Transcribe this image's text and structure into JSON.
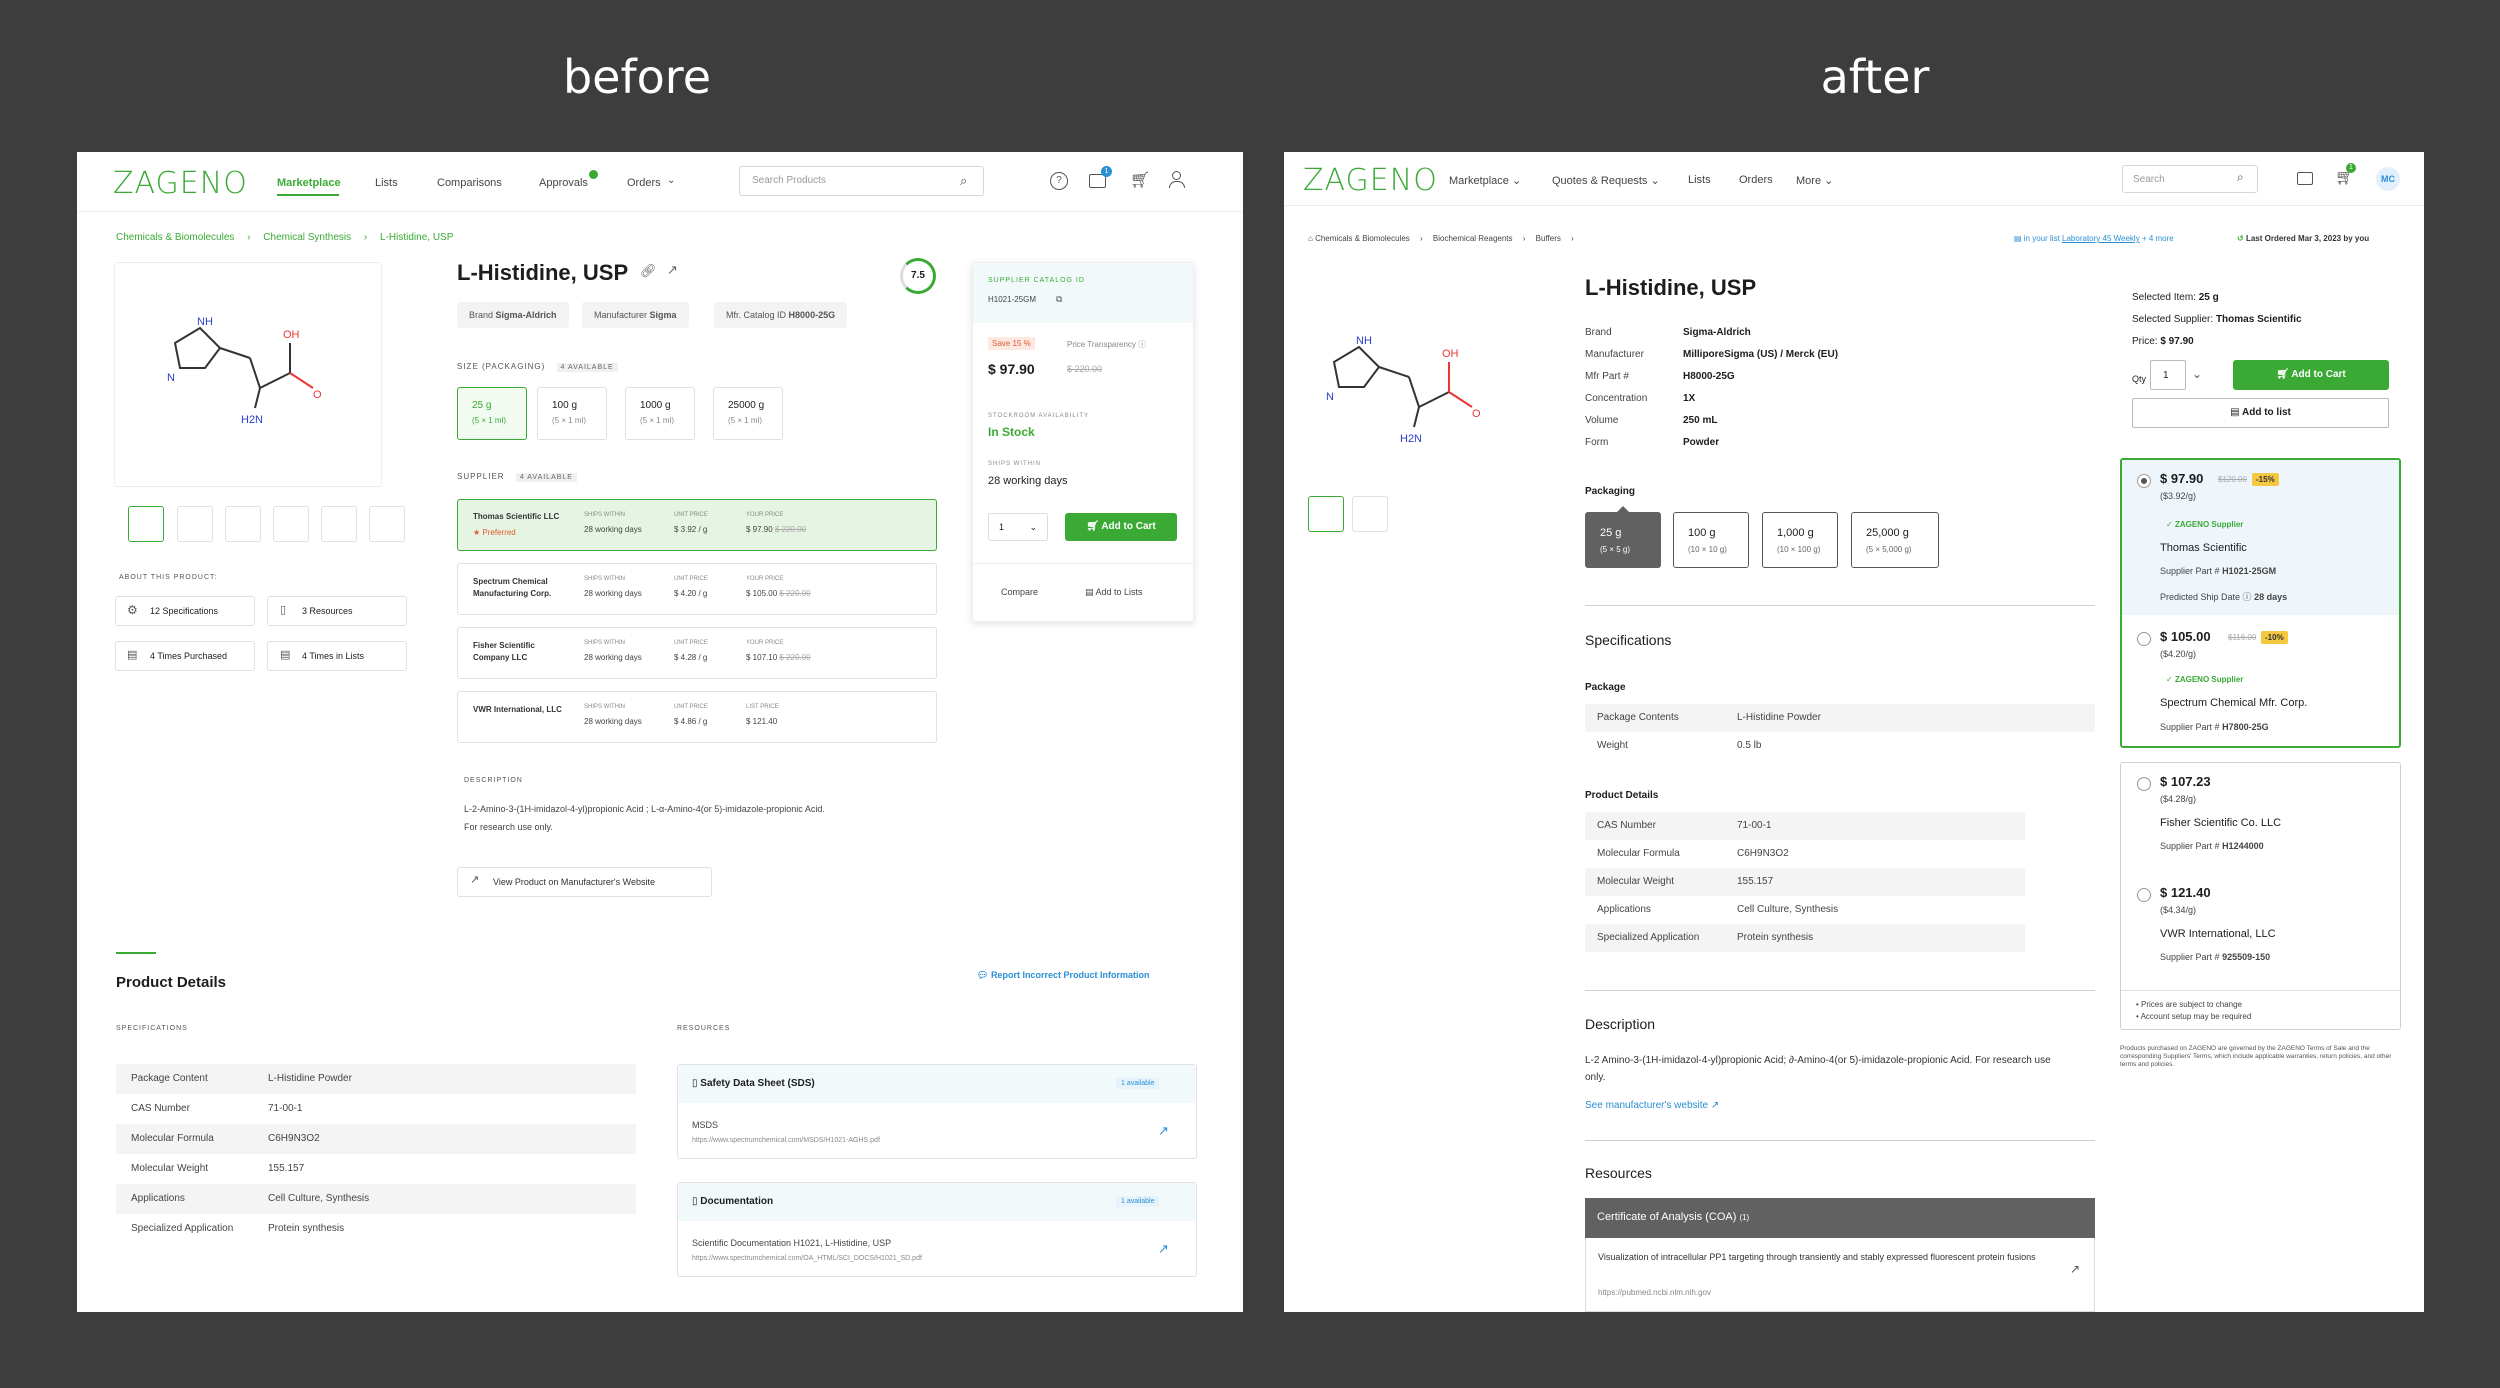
{
  "captions": {
    "before": "before",
    "after": "after"
  },
  "before": {
    "logo": "ZAGENO",
    "nav": [
      "Marketplace",
      "Lists",
      "Comparisons",
      "Approvals",
      "Orders"
    ],
    "search_placeholder": "Search Products",
    "cart_badge": "1",
    "breadcrumb": [
      "Chemicals & Biomolecules",
      "Chemical Synthesis",
      "L-Histidine, USP"
    ],
    "title": "L-Histidine, USP",
    "score": "7.5",
    "chips": {
      "brand_label": "Brand",
      "brand": "Sigma-Aldrich",
      "mfr_label": "Manufacturer",
      "mfr": "Sigma",
      "cat_label": "Mfr. Catalog ID",
      "cat": "H8000-25G"
    },
    "size_label": "SIZE (PACKAGING)",
    "size_avail": "4 available",
    "sizes": [
      {
        "v": "25 g",
        "s": "(5 × 1 ml)"
      },
      {
        "v": "100 g",
        "s": "(5 × 1 ml)"
      },
      {
        "v": "1000 g",
        "s": "(5 × 1 ml)"
      },
      {
        "v": "25000 g",
        "s": "(5 × 1 ml)"
      }
    ],
    "supplier_label": "SUPPLIER",
    "supplier_avail": "4 available",
    "col_ships": "SHIPS WITHIN",
    "col_unit": "UNIT PRICE",
    "col_your": "YOUR PRICE",
    "col_list": "LIST PRICE",
    "preferred": "Preferred",
    "suppliers": [
      {
        "name": "Thomas Scientific LLC",
        "ships": "28 working days",
        "unit": "$ 3.92 / g",
        "price": "$ 97.90",
        "old": "$ 220.00"
      },
      {
        "name": "Spectrum Chemical Manufacturing Corp.",
        "ships": "28 working days",
        "unit": "$ 4.20 / g",
        "price": "$ 105.00",
        "old": "$ 220.00"
      },
      {
        "name": "Fisher Scientific Company LLC",
        "ships": "28 working days",
        "unit": "$ 4.28 / g",
        "price": "$ 107.10",
        "old": "$ 220.00"
      },
      {
        "name": "VWR International, LLC",
        "ships": "28 working days",
        "unit": "$ 4.86 / g",
        "price": "$ 121.40",
        "old": ""
      }
    ],
    "about_label": "ABOUT THIS PRODUCT:",
    "about": [
      "12 Specifications",
      "3 Resources",
      "4 Times Purchased",
      "4 Times in Lists"
    ],
    "desc_label": "DESCRIPTION",
    "desc": "L-2-Amino-3-(1H-imidazol-4-yl)propionic Acid ; L-α-Amino-4(or 5)-imidazole-propionic Acid.",
    "desc2": "For research use only.",
    "mfr_link": "View Product on Manufacturer's Website",
    "card": {
      "cat_label": "SUPPLIER CATALOG ID",
      "cat": "H1021-25GM",
      "save": "Save 15 %",
      "transparency": "Price Transparency",
      "price": "$ 97.90",
      "old": "$ 220.00",
      "stock_label": "STOCKROOM AVAILABILITY",
      "stock": "In Stock",
      "ships_label": "SHIPS WITHIN",
      "ships": "28 working days",
      "qty": "1",
      "add": "Add to Cart",
      "compare": "Compare",
      "add_lists": "Add to Lists"
    },
    "details_title": "Product Details",
    "report": "Report Incorrect Product Information",
    "spec_label": "SPECIFICATIONS",
    "specs": [
      [
        "Package Content",
        "L-Histidine Powder"
      ],
      [
        "CAS Number",
        "71-00-1"
      ],
      [
        "Molecular Formula",
        "C6H9N3O2"
      ],
      [
        "Molecular Weight",
        "155.157"
      ],
      [
        "Applications",
        "Cell Culture, Synthesis"
      ],
      [
        "Specialized Application",
        "Protein synthesis"
      ]
    ],
    "res_label": "RESOURCES",
    "res": [
      {
        "title": "Safety Data Sheet (SDS)",
        "avail": "1 available",
        "item": "MSDS",
        "url": "https://www.spectrumchemical.com/MSDS/H1021-AGHS.pdf"
      },
      {
        "title": "Documentation",
        "avail": "1 available",
        "item": "Scientific Documentation H1021, L-Histidine, USP",
        "url": "https://www.spectrumchemical.com/OA_HTML/SCI_DOCS/H1021_SD.pdf"
      }
    ],
    "mol": {
      "oh": "OH",
      "o": "O",
      "nh": "NH",
      "n": "N",
      "h2n": "H2N"
    }
  },
  "after": {
    "logo": "ZAGENO",
    "nav": [
      "Marketplace",
      "Quotes & Requests",
      "Lists",
      "Orders",
      "More"
    ],
    "search_placeholder": "Search",
    "cart_badge": "1",
    "avatar": "MC",
    "breadcrumb": [
      "Chemicals & Biomolecules",
      "Biochemical Reagents",
      "Buffers"
    ],
    "in_list": "in your list",
    "list_name": "Laboratory 45 Weekly",
    "more": "+ 4 more",
    "last_ordered": "Last Ordered Mar 3, 2023 by you",
    "title": "L-Histidine, USP",
    "attrs": [
      [
        "Brand",
        "Sigma-Aldrich"
      ],
      [
        "Manufacturer",
        "MilliporeSigma (US) / Merck (EU)"
      ],
      [
        "Mfr Part #",
        "H8000-25G"
      ],
      [
        "Concentration",
        "1X"
      ],
      [
        "Volume",
        "250 mL"
      ],
      [
        "Form",
        "Powder"
      ]
    ],
    "pack_label": "Packaging",
    "packs": [
      {
        "v": "25 g",
        "s": "(5 × 5 g)"
      },
      {
        "v": "100 g",
        "s": "(10 × 10 g)"
      },
      {
        "v": "1,000 g",
        "s": "(10 × 100 g)"
      },
      {
        "v": "25,000 g",
        "s": "(5 × 5,000 g)"
      }
    ],
    "spec_title": "Specifications",
    "package_label": "Package",
    "package": [
      [
        "Package Contents",
        "L-Histidine Powder"
      ],
      [
        "Weight",
        "0.5 lb"
      ]
    ],
    "pd_label": "Product Details",
    "pd": [
      [
        "CAS Number",
        "71-00-1"
      ],
      [
        "Molecular Formula",
        "C6H9N3O2"
      ],
      [
        "Molecular Weight",
        "155.157"
      ],
      [
        "Applications",
        "Cell Culture, Synthesis"
      ],
      [
        "Specialized Application",
        "Protein synthesis"
      ]
    ],
    "desc_title": "Description",
    "desc": "L-2 Amino-3-(1H-imidazol-4-yl)propionic Acid; ∂-Amino-4(or 5)-imidazole-propionic Acid. For research use only.",
    "see_mfr": "See manufacturer's website",
    "res_title": "Resources",
    "coa": "Certificate of Analysis (COA)",
    "coa_count": "(1)",
    "coa_item": "Visualization of intracellular PP1 targeting through transiently and stably expressed fluorescent protein fusions",
    "coa_url": "https://pubmed.ncbi.nlm.nih.gov",
    "sel_item_label": "Selected Item:",
    "sel_item": "25 g",
    "sel_sup_label": "Selected Supplier:",
    "sel_sup": "Thomas Scientific",
    "price_label": "Price:",
    "price": "$ 97.90",
    "qty_label": "Qty",
    "qty": "1",
    "add": "Add to Cart",
    "add_list": "Add to list",
    "zsupplier": "ZAGENO Supplier",
    "supplier_part": "Supplier Part #",
    "predicted": "Predicted Ship Date",
    "predicted_v": "28 days",
    "offers": [
      {
        "price": "$ 97.90",
        "old": "$120.00",
        "disc": "-15%",
        "unit": "($3.92/g)",
        "name": "Thomas Scientific",
        "part": "H1021-25GM"
      },
      {
        "price": "$ 105.00",
        "old": "$116.00",
        "disc": "-10%",
        "unit": "($4.20/g)",
        "name": "Spectrum Chemical Mfr. Corp.",
        "part": "H7800-25G"
      },
      {
        "price": "$ 107.23",
        "unit": "($4.28/g)",
        "name": "Fisher Scientific Co. LLC",
        "part": "H1244000"
      },
      {
        "price": "$ 121.40",
        "unit": "($4.34/g)",
        "name": "VWR International, LLC",
        "part": "925509-150"
      }
    ],
    "notes": [
      "Prices are subject to change",
      "Account setup may be required"
    ],
    "terms": "Products purchased on ZAGENO are governed by the ZAGENO Terms of Sale and the corresponding Suppliers' Terms, which include applicable warranties, return policies, and other terms and policies.",
    "mol": {
      "oh": "OH",
      "o": "O",
      "nh": "NH",
      "n": "N",
      "h2n": "H2N"
    }
  }
}
